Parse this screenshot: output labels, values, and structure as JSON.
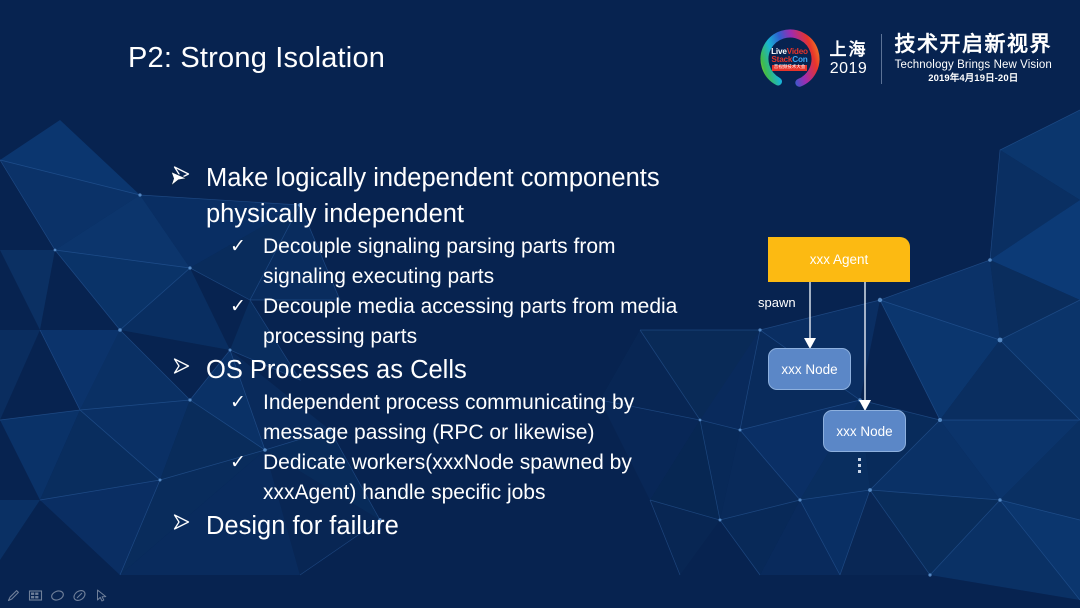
{
  "slide": {
    "title": "P2: Strong Isolation",
    "background_color": "#072350"
  },
  "logo": {
    "mark_line1_word1": "Live",
    "mark_line1_word2": "Video",
    "mark_line2_word1": "Stack",
    "mark_line2_word2": "Con",
    "mark_line3": "音视频技术大会",
    "city": "上海",
    "year": "2019",
    "slogan_cn": "技术开启新视界",
    "slogan_en": "Technology Brings New Vision",
    "slogan_date": "2019年4月19日-20日"
  },
  "bullets": [
    {
      "level": 1,
      "text": "Make logically independent components physically independent"
    },
    {
      "level": 2,
      "text": "Decouple signaling parsing parts from signaling executing parts"
    },
    {
      "level": 2,
      "text": "Decouple media accessing parts from media processing parts"
    },
    {
      "level": 1,
      "text": "OS Processes as Cells"
    },
    {
      "level": 2,
      "text": "Independent process communicating by message passing (RPC or likewise)"
    },
    {
      "level": 2,
      "text": "Dedicate workers(xxxNode spawned by xxxAgent) handle specific jobs"
    },
    {
      "level": 1,
      "text": "Design for failure"
    }
  ],
  "diagram": {
    "agent_label": "xxx Agent",
    "node1_label": "xxx Node",
    "node2_label": "xxx Node",
    "edge_label": "spawn",
    "continuation": "⋮",
    "agent_color": "#fcba12",
    "node_color": "#5b87c7",
    "node_border_color": "#8db0de"
  },
  "toolbar": {
    "items": [
      {
        "name": "pen-icon"
      },
      {
        "name": "slide-grid-icon"
      },
      {
        "name": "laser-pointer-icon"
      },
      {
        "name": "eraser-icon"
      },
      {
        "name": "arrow-pointer-icon"
      }
    ]
  }
}
